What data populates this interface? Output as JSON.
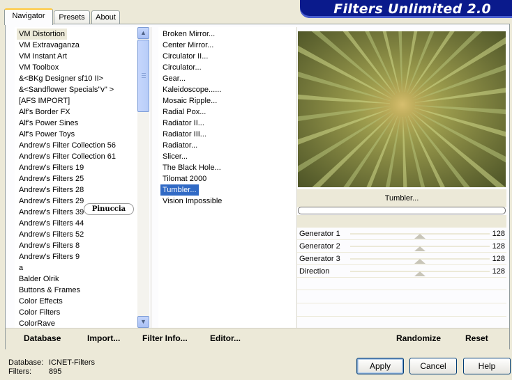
{
  "tabs": [
    "Navigator",
    "Presets",
    "About"
  ],
  "banner_title": "Filters Unlimited 2.0",
  "categories": [
    "VM Distortion",
    "VM Extravaganza",
    "VM Instant Art",
    "VM Toolbox",
    "&<BKg Designer sf10 II>",
    "&<Sandflower Specials\"v\" >",
    "[AFS IMPORT]",
    "Alf's Border FX",
    "Alf's Power Sines",
    "Alf's Power Toys",
    "Andrew's Filter Collection 56",
    "Andrew's Filter Collection 61",
    "Andrew's Filters 19",
    "Andrew's Filters 25",
    "Andrew's Filters 28",
    "Andrew's Filters 29",
    "Andrew's Filters 39",
    "Andrew's Filters 44",
    "Andrew's Filters 52",
    "Andrew's Filters 8",
    "Andrew's Filters 9",
    "a",
    "Balder Olrik",
    "Buttons & Frames",
    "Color Effects",
    "Color Filters",
    "ColorRave"
  ],
  "selected_category_index": 0,
  "filters": [
    "Broken Mirror...",
    "Center Mirror...",
    "Circulator II...",
    "Circulator...",
    "Gear...",
    "Kaleidoscope......",
    "Mosaic Ripple...",
    "Radial Pox...",
    "Radiator II...",
    "Radiator III...",
    "Radiator...",
    "Slicer...",
    "The Black Hole...",
    "Tilomat 2000",
    "Tumbler...",
    "Vision Impossible"
  ],
  "selected_filter_index": 14,
  "watermark_text": "Pinuccia",
  "current_filter_name": "Tumbler...",
  "progress": 0,
  "sliders": [
    {
      "label": "Generator 1",
      "value": "128",
      "fraction": 0.502
    },
    {
      "label": "Generator 2",
      "value": "128",
      "fraction": 0.502
    },
    {
      "label": "Generator 3",
      "value": "128",
      "fraction": 0.502
    },
    {
      "label": "Direction",
      "value": "128",
      "fraction": 0.502
    }
  ],
  "bottom_buttons": {
    "database": "Database",
    "import": "Import...",
    "filter_info": "Filter Info...",
    "editor": "Editor...",
    "randomize": "Randomize",
    "reset": "Reset"
  },
  "footer": {
    "database_label": "Database:",
    "database_value": "ICNET-Filters",
    "filters_label": "Filters:",
    "filters_value": "895"
  },
  "dialog_buttons": {
    "apply": "Apply",
    "cancel": "Cancel",
    "help": "Help"
  },
  "icons": {
    "scroll_up": "scroll-up-arrow-icon",
    "scroll_down": "scroll-down-arrow-icon"
  },
  "colors": {
    "selection": "#316ac5",
    "banner": "#0a1a8c",
    "tab_highlight": "#ffc83c"
  }
}
